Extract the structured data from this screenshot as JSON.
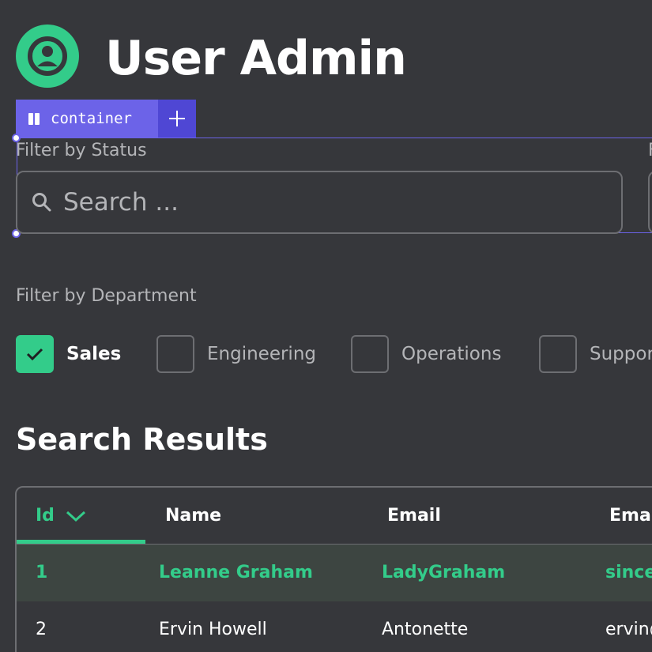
{
  "header": {
    "title": "User Admin",
    "logo_icon": "user-circle-icon"
  },
  "editor": {
    "container_label": "container"
  },
  "filters": {
    "status_label": "Filter by Status",
    "second_label": "F",
    "search_placeholder": "Search ...",
    "department_label": "Filter by Department",
    "departments": [
      {
        "label": "Sales",
        "checked": true
      },
      {
        "label": "Engineering",
        "checked": false
      },
      {
        "label": "Operations",
        "checked": false
      },
      {
        "label": "Support",
        "checked": false
      }
    ]
  },
  "results": {
    "title": "Search Results",
    "columns": [
      "Id",
      "Name",
      "Email",
      "Email"
    ],
    "sorted_column": "Id",
    "rows": [
      {
        "id": "1",
        "name": "Leanne Graham",
        "username": "LadyGraham",
        "email": "sincere@april.biz",
        "selected": true
      },
      {
        "id": "2",
        "name": "Ervin Howell",
        "username": "Antonette",
        "email": "ervin@melissa.tv",
        "selected": false
      }
    ]
  },
  "colors": {
    "accent": "#33cc8a",
    "editor": "#6c63e8",
    "background": "#36373b"
  }
}
